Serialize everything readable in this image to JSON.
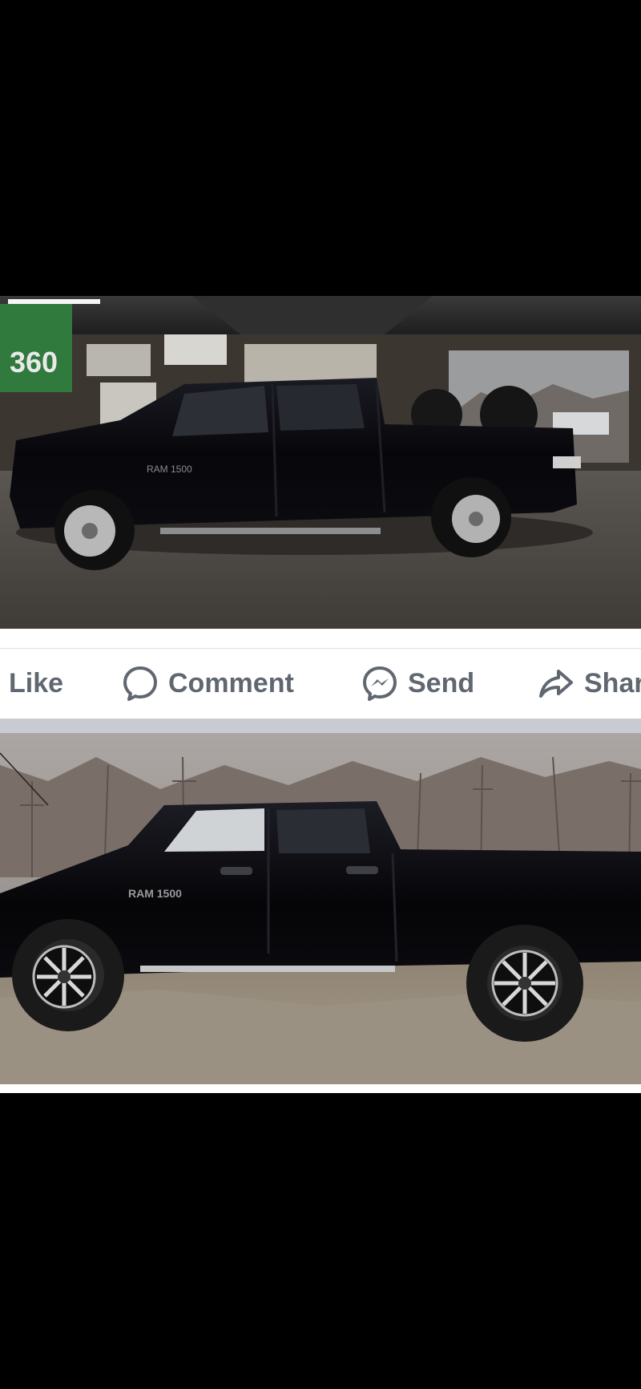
{
  "post": {
    "actions": {
      "like_label": "Like",
      "comment_label": "Comment",
      "send_label": "Send",
      "share_label": "Shar"
    },
    "icons": {
      "comment": "speech-bubble-icon",
      "send": "messenger-icon",
      "share": "share-arrow-icon"
    },
    "photos": [
      {
        "sign_text": "360",
        "badge_text": "RAM 1500"
      },
      {
        "badge_text": "RAM 1500"
      }
    ]
  },
  "colors": {
    "action_text": "#606770",
    "separator": "#c8ccd2",
    "background": "#000000"
  }
}
